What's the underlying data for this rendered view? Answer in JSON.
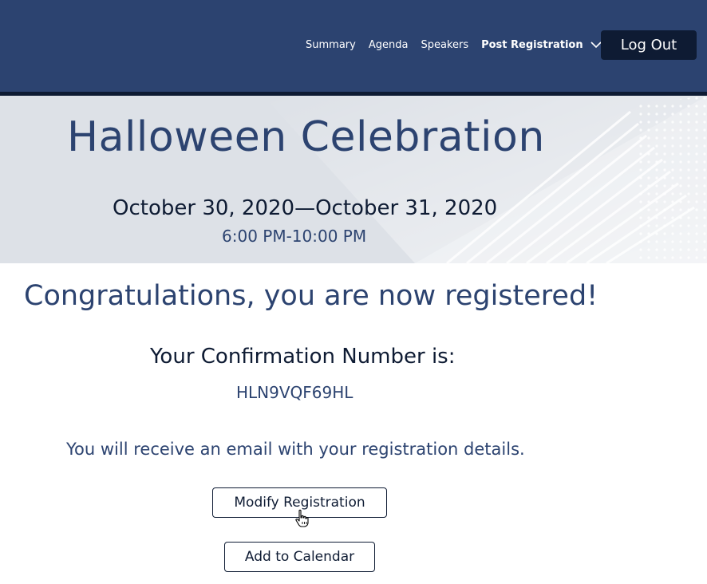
{
  "nav": {
    "items": [
      {
        "label": "Summary"
      },
      {
        "label": "Agenda"
      },
      {
        "label": "Speakers"
      },
      {
        "label": "Post Registration"
      }
    ],
    "logout_label": "Log Out"
  },
  "banner": {
    "title": "Halloween Celebration",
    "dates": "October 30, 2020—October 31, 2020",
    "times": "6:00 PM-10:00 PM"
  },
  "main": {
    "congrats": "Congratulations, you are now registered!",
    "confirmation_label": "Your Confirmation Number is:",
    "confirmation_number": "HLN9VQF69HL",
    "email_note": "You will receive an email with your registration details.",
    "modify_label": "Modify Registration",
    "calendar_label": "Add to Calendar"
  },
  "colors": {
    "header_bg": "#2c4370",
    "header_border": "#0e1b33",
    "banner_bg": "#dde1e7",
    "accent_text": "#2c4370",
    "dark_text": "#0e1b33"
  },
  "icons": {
    "nav_dropdown": "chevron-down-icon",
    "mouse_cursor": "hand-pointer-icon"
  }
}
